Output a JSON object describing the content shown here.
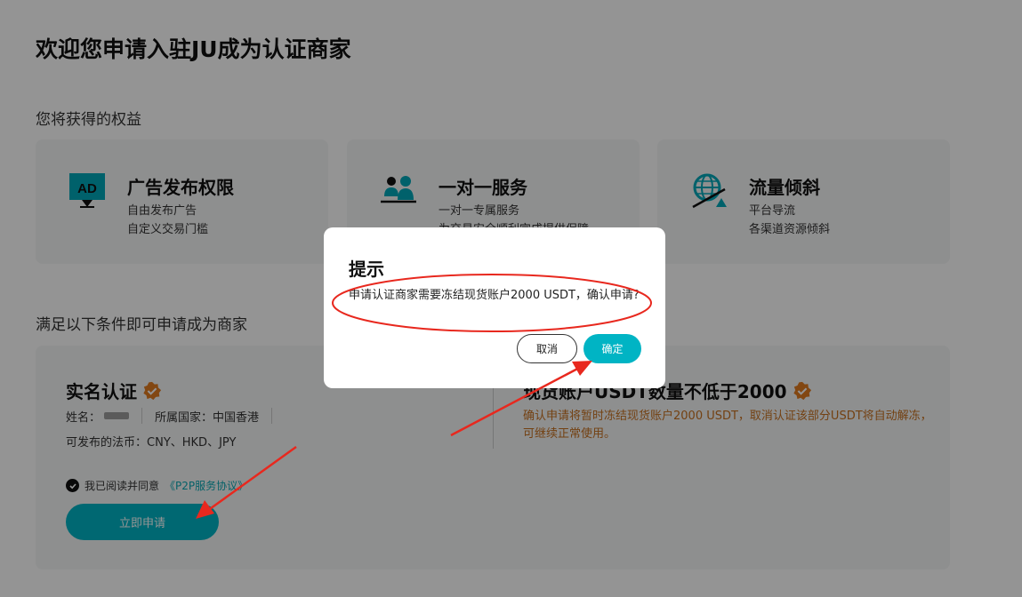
{
  "page": {
    "title": "欢迎您申请入驻JU成为认证商家",
    "benefits_title": "您将获得的权益",
    "conditions_title": "满足以下条件即可申请成为商家"
  },
  "benefits": [
    {
      "icon": "ad-icon",
      "title": "广告发布权限",
      "line1": "自由发布广告",
      "line2": "自定义交易门槛"
    },
    {
      "icon": "users-icon",
      "title": "一对一服务",
      "line1": "一对一专属服务",
      "line2": "为交易安全顺利完成提供保障"
    },
    {
      "icon": "globe-icon",
      "title": "流量倾斜",
      "line1": "平台导流",
      "line2": "各渠道资源倾斜"
    }
  ],
  "conditions": {
    "left": {
      "title": "实名认证",
      "name_label": "姓名：",
      "country_label": "所属国家：",
      "country_value": "中国香港",
      "currencies_label": "可发布的法币：",
      "currencies_value": "CNY、HKD、JPY"
    },
    "right": {
      "title": "现货账户USDT数量不低于2000",
      "note": "确认申请将暂时冻结现货账户2000 USDT，取消认证该部分USDT将自动解冻，可继续正常使用。"
    },
    "agree_text": "我已阅读并同意",
    "agree_link": "《P2P服务协议》",
    "apply_label": "立即申请"
  },
  "modal": {
    "title": "提示",
    "message": "申请认证商家需要冻结现货账户2000 USDT，确认申请?",
    "cancel_label": "取消",
    "confirm_label": "确定"
  },
  "colors": {
    "accent": "#00b4c4",
    "warning_text": "#c7701f",
    "badge": "#e07a1f",
    "annotation": "#e8281e"
  }
}
